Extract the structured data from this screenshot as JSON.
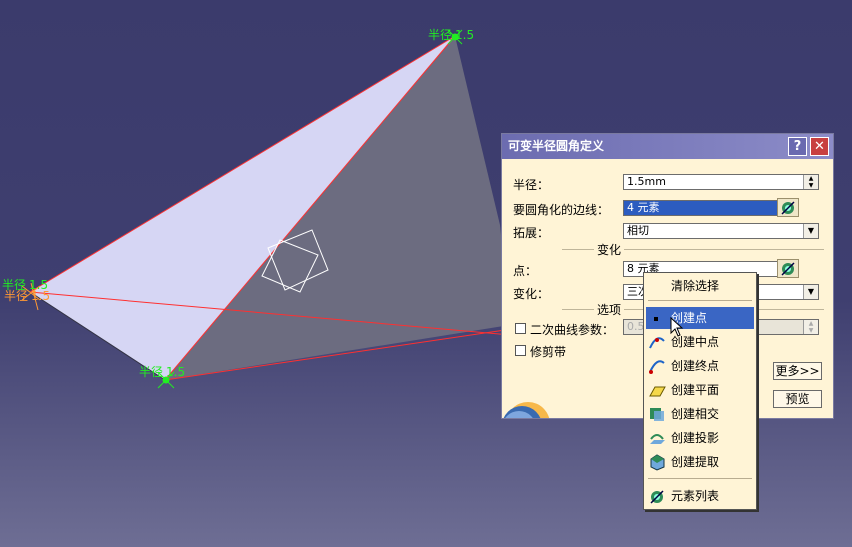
{
  "annotations": {
    "radius_label": "半径",
    "radius_value": "1.5"
  },
  "dialog": {
    "title": "可变半径圆角定义",
    "help": "?",
    "close": "✕",
    "radius_label": "半径：",
    "radius_value": "1.5mm",
    "edges_label": "要圆角化的边线：",
    "edges_value": "4 元素",
    "extend_label": "拓展：",
    "extend_value": "相切",
    "variation_section": "变化",
    "points_label": "点：",
    "points_value": "8 元素",
    "variation_label": "变化：",
    "variation_value": "三次",
    "options_section": "选项",
    "conic_label": "二次曲线参数：",
    "conic_value": "0.5",
    "trim_label": "修剪带",
    "more_button": "更多>>",
    "preview_button": "预览"
  },
  "context_menu": {
    "items": [
      {
        "label": "清除选择",
        "icon": "none"
      },
      {
        "label": "创建点",
        "icon": "point-icon",
        "highlighted": true
      },
      {
        "label": "创建中点",
        "icon": "midpoint-icon"
      },
      {
        "label": "创建终点",
        "icon": "endpoint-icon"
      },
      {
        "label": "创建平面",
        "icon": "plane-icon"
      },
      {
        "label": "创建相交",
        "icon": "intersection-icon"
      },
      {
        "label": "创建投影",
        "icon": "projection-icon"
      },
      {
        "label": "创建提取",
        "icon": "extract-icon"
      },
      {
        "label": "元素列表",
        "icon": "element-list-icon"
      }
    ]
  },
  "colors": {
    "background": "#3b3b6c",
    "annotation": "#22ee22",
    "edge": "#ff3030",
    "highlight": "#3a66c4"
  }
}
